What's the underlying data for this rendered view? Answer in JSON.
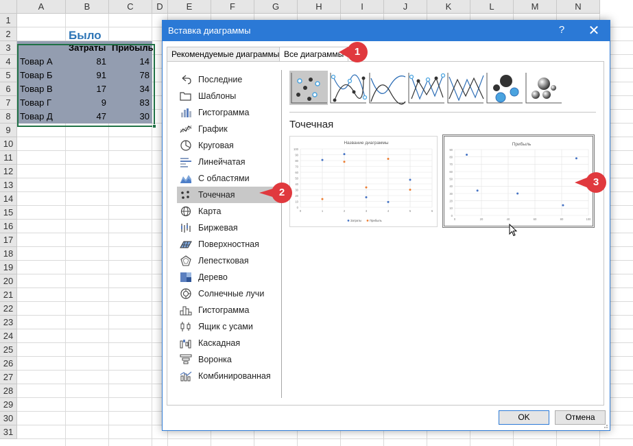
{
  "sheet": {
    "columns": [
      "A",
      "B",
      "C",
      "D",
      "E",
      "F",
      "G",
      "H",
      "I",
      "J",
      "K",
      "L",
      "M",
      "N"
    ],
    "rows": [
      "1",
      "2",
      "3",
      "4",
      "5",
      "6",
      "7",
      "8",
      "9",
      "10",
      "11",
      "12",
      "13",
      "14",
      "15",
      "16",
      "17",
      "18",
      "19",
      "20",
      "21",
      "22",
      "23",
      "24",
      "25",
      "26",
      "27",
      "28",
      "29",
      "30",
      "31"
    ],
    "title": "Было",
    "header": [
      "",
      "Затраты",
      "Прибыль"
    ],
    "data": [
      [
        "Товар А",
        "81",
        "14"
      ],
      [
        "Товар Б",
        "91",
        "78"
      ],
      [
        "Товар В",
        "17",
        "34"
      ],
      [
        "Товар Г",
        "9",
        "83"
      ],
      [
        "Товар Д",
        "47",
        "30"
      ]
    ]
  },
  "dialog": {
    "title": "Вставка диаграммы",
    "help": "?",
    "close": "✕",
    "tabs": [
      "Рекомендуемые диаграммы",
      "Все диаграммы"
    ],
    "active_tab": 1,
    "chart_types": [
      {
        "label": "Последние",
        "icon": "undo-arrow-icon"
      },
      {
        "label": "Шаблоны",
        "icon": "folder-icon"
      },
      {
        "label": "Гистограмма",
        "icon": "column-chart-icon"
      },
      {
        "label": "График",
        "icon": "line-chart-icon"
      },
      {
        "label": "Круговая",
        "icon": "pie-chart-icon"
      },
      {
        "label": "Линейчатая",
        "icon": "bar-chart-icon"
      },
      {
        "label": "С областями",
        "icon": "area-chart-icon"
      },
      {
        "label": "Точечная",
        "icon": "scatter-chart-icon"
      },
      {
        "label": "Карта",
        "icon": "globe-icon"
      },
      {
        "label": "Биржевая",
        "icon": "stock-chart-icon"
      },
      {
        "label": "Поверхностная",
        "icon": "surface-chart-icon"
      },
      {
        "label": "Лепестковая",
        "icon": "radar-chart-icon"
      },
      {
        "label": "Дерево",
        "icon": "treemap-icon"
      },
      {
        "label": "Солнечные лучи",
        "icon": "sunburst-icon"
      },
      {
        "label": "Гистограмма",
        "icon": "histogram-icon"
      },
      {
        "label": "Ящик с усами",
        "icon": "box-whisker-icon"
      },
      {
        "label": "Каскадная",
        "icon": "waterfall-icon"
      },
      {
        "label": "Воронка",
        "icon": "funnel-icon"
      },
      {
        "label": "Комбинированная",
        "icon": "combo-chart-icon"
      }
    ],
    "selected_type": 7,
    "subtypes": [
      "scatter",
      "scatter-smooth-markers",
      "scatter-smooth",
      "scatter-straight-markers",
      "scatter-straight",
      "bubble",
      "bubble-3d"
    ],
    "selected_subtype": 0,
    "section_title": "Точечная",
    "ok": "OK",
    "cancel": "Отмена"
  },
  "chart_data": [
    {
      "type": "scatter",
      "title": "Название диаграммы",
      "xlim": [
        0,
        6
      ],
      "ylim": [
        0,
        100
      ],
      "xticks": [
        "0",
        "1",
        "2",
        "3",
        "4",
        "5",
        "6"
      ],
      "yticks": [
        "0",
        "10",
        "20",
        "30",
        "40",
        "50",
        "60",
        "70",
        "80",
        "90",
        "100"
      ],
      "grid": true,
      "legend": "bottom",
      "series": [
        {
          "name": "Затраты",
          "color": "#4472c4",
          "x": [
            1,
            2,
            3,
            4,
            5
          ],
          "y": [
            81,
            91,
            17,
            9,
            47
          ]
        },
        {
          "name": "Прибыль",
          "color": "#ed7d31",
          "x": [
            1,
            2,
            3,
            4,
            5
          ],
          "y": [
            14,
            78,
            34,
            83,
            30
          ]
        }
      ]
    },
    {
      "type": "scatter",
      "title": "Прибыль",
      "xlim": [
        0,
        100
      ],
      "ylim": [
        0,
        90
      ],
      "xticks": [
        "0",
        "20",
        "40",
        "60",
        "80",
        "100"
      ],
      "yticks": [
        "0",
        "10",
        "20",
        "30",
        "40",
        "50",
        "60",
        "70",
        "80",
        "90"
      ],
      "grid": true,
      "series": [
        {
          "color": "#4472c4",
          "x": [
            81,
            91,
            17,
            9,
            47
          ],
          "y": [
            14,
            78,
            34,
            83,
            30
          ]
        }
      ]
    }
  ],
  "callouts": [
    "1",
    "2",
    "3"
  ],
  "colors": {
    "accent": "#2b79d6",
    "callout": "#e0393e",
    "selection": "#939db0",
    "title": "#2e75b6"
  }
}
